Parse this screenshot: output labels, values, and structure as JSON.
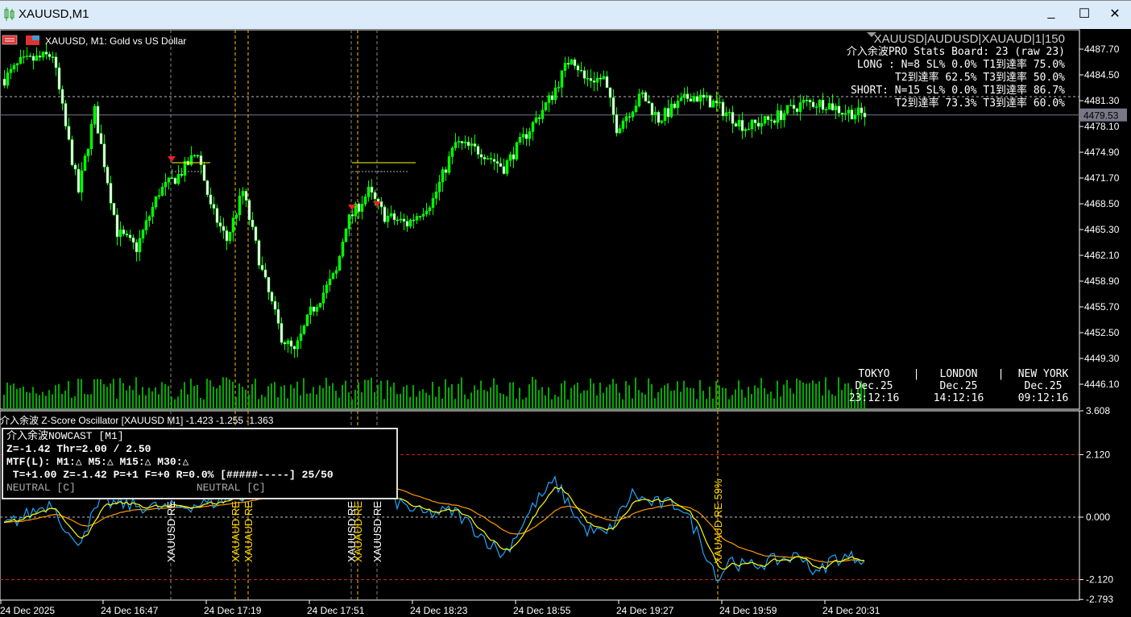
{
  "window": {
    "title": "XAUUSD,M1",
    "minimize": "_",
    "maximize": "☐",
    "close": "✕"
  },
  "chart_header": {
    "symbol_desc": "XAUUSD, M1:  Gold vs US Dollar"
  },
  "stats_board": {
    "pairs": "XAUUSD|AUDUSD|XAUAUD|1|150",
    "title": "介入余波PRO Stats Board: 23 (raw 23)",
    "long1": "LONG : N=8  SL% 0.0%  T1到達率 75.0%",
    "long2": "T2到達率 62.5%  T3到達率 50.0%",
    "short1": "SHORT: N=15  SL% 0.0%  T1到達率 86.7%",
    "short2": "T2到達率 73.3%  T3到達率 60.0%"
  },
  "sessions": [
    {
      "name": "TOKYO",
      "date": "Dec.25",
      "time": "23:12:16"
    },
    {
      "name": "LONDON",
      "date": "Dec.25",
      "time": "14:12:16"
    },
    {
      "name": "NEW YORK",
      "date": "Dec.25",
      "time": "09:12:16"
    }
  ],
  "sep": "|",
  "price_axis": {
    "labels": [
      "4487.70",
      "4484.50",
      "4481.30",
      "4478.10",
      "4474.90",
      "4471.70",
      "4468.50",
      "4465.30",
      "4462.10",
      "4458.90",
      "4455.70",
      "4452.50",
      "4449.30",
      "4446.10"
    ],
    "current": "4479.53"
  },
  "oscillator": {
    "header": "介入余波 Z-Score Oscillator [XAUUSD M1] -1.423 -1.255 -1.363",
    "axis": [
      "3.608",
      "2.120",
      "0.000",
      "-2.120",
      "-2.793"
    ],
    "nowcast": {
      "l1": "介入余波NOWCAST [M1]",
      "l2": "Z=-1.42  Thr=2.00 / 2.50",
      "l3": "MTF(L): M1:△ M5:△ M15:△ M30:△",
      "l4": " T=+1.00 Z=-1.42 P=+1 F=+0 R=0.0% [#####-----] 25/50",
      "l5a": "NEUTRAL [C]",
      "l5b": "NEUTRAL [C]"
    }
  },
  "event_labels": [
    {
      "text": "XAUUSD RE",
      "color": "#ffffff"
    },
    {
      "text": "XAUAUD RE",
      "color": "#ffd700"
    },
    {
      "text": "XAUAUD RE",
      "color": "#ffd700"
    },
    {
      "text": "XAUUSD RE",
      "color": "#ffffff"
    },
    {
      "text": "XAUAUD RE",
      "color": "#ffd700"
    },
    {
      "text": "XAUUSD RE",
      "color": "#ffffff"
    },
    {
      "text": "XAUAUD RE 59%",
      "color": "#ffd700"
    }
  ],
  "time_axis": [
    "24 Dec 2025",
    "24 Dec 16:47",
    "24 Dec 17:19",
    "24 Dec 17:51",
    "24 Dec 18:23",
    "24 Dec 18:55",
    "24 Dec 19:27",
    "24 Dec 19:59",
    "24 Dec 20:31"
  ],
  "chart_data": {
    "type": "candlestick",
    "bar_minutes": 1,
    "price_keypoints": [
      [
        0,
        4484
      ],
      [
        5,
        4486
      ],
      [
        15,
        4487
      ],
      [
        19,
        4478
      ],
      [
        23,
        4470
      ],
      [
        28,
        4480
      ],
      [
        35,
        4465
      ],
      [
        41,
        4463
      ],
      [
        48,
        4470
      ],
      [
        54,
        4472
      ],
      [
        60,
        4475
      ],
      [
        64,
        4468
      ],
      [
        69,
        4464
      ],
      [
        74,
        4470
      ],
      [
        80,
        4460
      ],
      [
        86,
        4452
      ],
      [
        90,
        4450
      ],
      [
        95,
        4455
      ],
      [
        103,
        4460
      ],
      [
        106,
        4466
      ],
      [
        113,
        4470
      ],
      [
        118,
        4467
      ],
      [
        125,
        4466
      ],
      [
        133,
        4469
      ],
      [
        140,
        4476
      ],
      [
        148,
        4475
      ],
      [
        155,
        4473
      ],
      [
        160,
        4476
      ],
      [
        170,
        4482
      ],
      [
        176,
        4487
      ],
      [
        180,
        4484
      ],
      [
        186,
        4484
      ],
      [
        190,
        4478
      ],
      [
        198,
        4482
      ],
      [
        203,
        4479
      ],
      [
        213,
        4482
      ],
      [
        220,
        4481
      ],
      [
        230,
        4478
      ],
      [
        238,
        4479
      ],
      [
        248,
        4481
      ],
      [
        255,
        4481
      ],
      [
        260,
        4480
      ],
      [
        268,
        4479.5
      ]
    ],
    "zscore_keypoints": [
      [
        0,
        -0.3
      ],
      [
        15,
        0.5
      ],
      [
        22,
        -1
      ],
      [
        30,
        0.5
      ],
      [
        50,
        0.3
      ],
      [
        65,
        0.5
      ],
      [
        85,
        1
      ],
      [
        105,
        1.5
      ],
      [
        120,
        0.6
      ],
      [
        130,
        0.1
      ],
      [
        140,
        0.2
      ],
      [
        150,
        -0.8
      ],
      [
        155,
        -1.3
      ],
      [
        165,
        0.5
      ],
      [
        171,
        1.2
      ],
      [
        175,
        0.5
      ],
      [
        180,
        -0.4
      ],
      [
        187,
        -0.6
      ],
      [
        195,
        0.8
      ],
      [
        200,
        0.5
      ],
      [
        210,
        0.4
      ],
      [
        215,
        -0.5
      ],
      [
        219,
        -1.5
      ],
      [
        222,
        -2.1
      ],
      [
        225,
        -1.4
      ],
      [
        230,
        -1.7
      ],
      [
        238,
        -1.5
      ],
      [
        248,
        -1.3
      ],
      [
        252,
        -2.0
      ],
      [
        257,
        -1.4
      ],
      [
        268,
        -1.35
      ]
    ],
    "series": [
      "Z fast",
      "Z signal",
      "Z slow"
    ],
    "colors": {
      "fast": "#1ea7ff",
      "signal": "#ffff00",
      "slow": "#ff9900",
      "bull": "#00ff00",
      "bear": "#ffffff"
    }
  }
}
